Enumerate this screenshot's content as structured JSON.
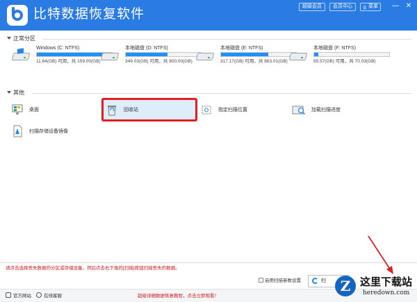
{
  "window": {
    "title": "比特数据恢复软件",
    "buttons": {
      "super_member": "超级会员",
      "member_center": "会员中心",
      "menu": "菜单"
    },
    "controls": {
      "minimize": "—",
      "close": "✕"
    }
  },
  "sections": {
    "partitions": "正常分区",
    "other": "其他"
  },
  "drives": [
    {
      "name": "Windows (C: NTFS)",
      "size": "11.64(GB) 可用，共 159.00(GB)",
      "used_fraction": 0.93
    },
    {
      "name": "本地磁盘 (D: NTFS)",
      "size": "349.03(GB) 可用，共 800.00(GB)",
      "used_fraction": 0.56
    },
    {
      "name": "本地磁盘 (E: NTFS)",
      "size": "317.17(GB) 可用，共 863.01(GB)",
      "used_fraction": 0.63
    },
    {
      "name": "本地磁盘 (F: NTFS)",
      "size": "65.57(GB) 可用，共 70.03(GB)",
      "used_fraction": 0.06
    }
  ],
  "tools": {
    "desktop": "桌面",
    "recycle_bin": "回收站",
    "specify_location": "指定扫描位置",
    "load_progress": "加载扫描进度",
    "scan_image": "扫描存储设备镜像"
  },
  "bottom": {
    "hint": "请点击选择丢失数据的分区或存储设备，然后点击右下角的[扫描]按钮扫描丢失的数据。",
    "enable_params": "启用扫描参数设置",
    "next_button": "扫"
  },
  "footer": {
    "website": "官方网站",
    "support": "在线客服",
    "promo": "超级详细数据恢复教程，点击立即观看！"
  },
  "watermark": {
    "logo_letter": "Z",
    "title": "这里下载站",
    "url": "heredown.com"
  },
  "colors": {
    "title_bar": "#2a7be4",
    "progress": "#1e90ff",
    "highlight_border": "#e02020",
    "hint_text": "#d9151b"
  }
}
